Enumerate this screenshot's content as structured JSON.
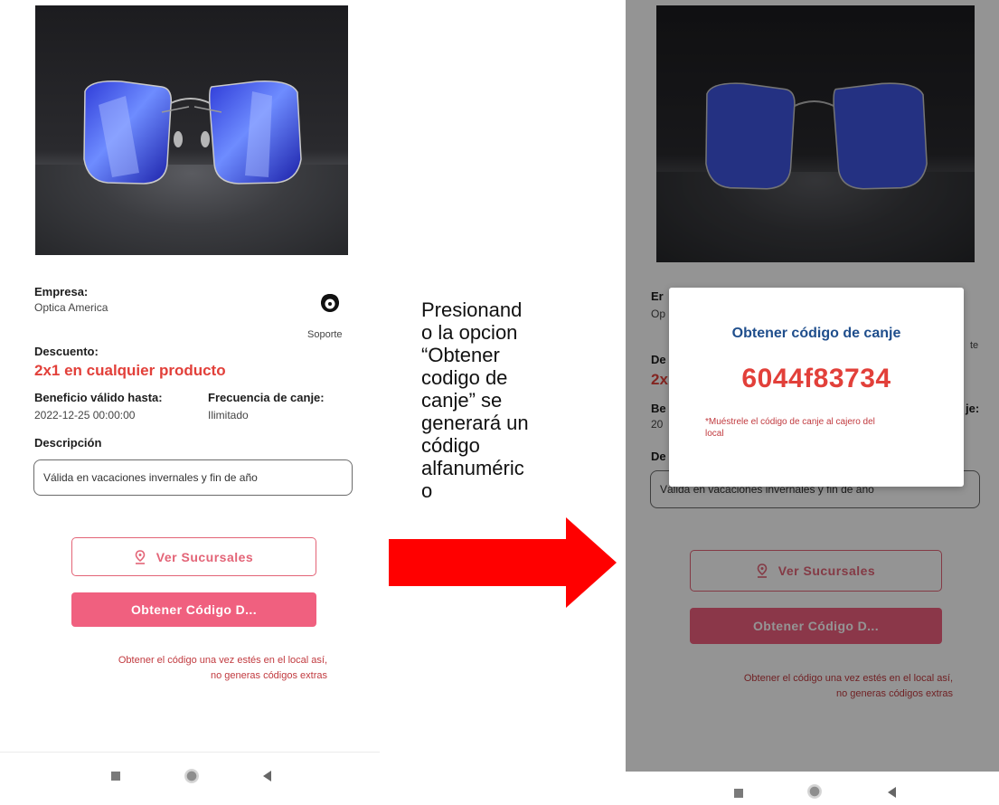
{
  "screen": {
    "empresa_label": "Empresa:",
    "empresa_value": "Optica America",
    "support_label": "Soporte",
    "descuento_label": "Descuento:",
    "descuento_value": "2x1 en cualquier producto",
    "beneficio_label": "Beneficio válido hasta:",
    "beneficio_value": "2022-12-25 00:00:00",
    "frecuencia_label": "Frecuencia de canje:",
    "frecuencia_value": "Ilimitado",
    "descripcion_label": "Descripción",
    "descripcion_value": "Válida en vacaciones invernales y fin de año",
    "ver_sucursales": "Ver Sucursales",
    "obtener_codigo": "Obtener Código D...",
    "note_line1": "Obtener el código una vez estés en el local así,",
    "note_line2": "no generas códigos extras"
  },
  "caption_lines": [
    "Presionand",
    "o la opcion",
    "“Obtener",
    "codigo de",
    "canje” se",
    "generará un",
    "código",
    "alfanuméric",
    "o"
  ],
  "modal": {
    "title": "Obtener código de canje",
    "code": "6044f83734",
    "hint_line1": "*Muéstrele el código de canje al cajero del",
    "hint_line2": "local"
  },
  "right_partial": {
    "empresa": "Er",
    "empresa_value": "Op",
    "soporte": "te",
    "desc": "De",
    "desc_value": "2x",
    "beneficio": "Be",
    "frecuencia": "je:",
    "fecha": "20",
    "descripcion": "De"
  },
  "colors": {
    "accent_red": "#e2403a",
    "button_pink": "#f0607f",
    "outline_pink": "#e36477",
    "modal_title_blue": "#1f4e8c",
    "arrow_red": "#ff0000"
  },
  "icons": {
    "support": "support-agent-icon",
    "location": "location-pin-icon",
    "nav_recent": "square-icon",
    "nav_home": "circle-icon",
    "nav_back": "back-triangle-icon"
  }
}
